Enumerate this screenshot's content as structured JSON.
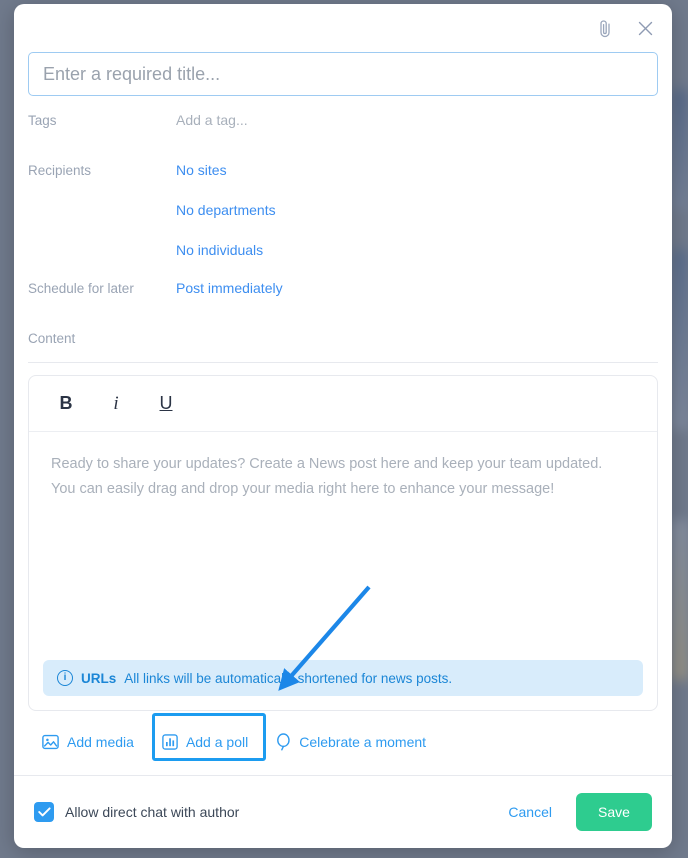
{
  "modal": {
    "header": {
      "attach_icon": "paperclip-icon",
      "close_icon": "close-icon"
    },
    "title_input": {
      "value": "",
      "placeholder": "Enter a required title..."
    },
    "fields": {
      "tags": {
        "label": "Tags",
        "value": "Add a tag..."
      },
      "recipients": {
        "label": "Recipients",
        "values": [
          "No sites",
          "No departments",
          "No individuals"
        ]
      },
      "schedule": {
        "label": "Schedule for later",
        "value": "Post immediately"
      },
      "content": {
        "label": "Content"
      }
    },
    "editor": {
      "toolbar": {
        "bold": "B",
        "italic": "i",
        "underline": "U"
      },
      "placeholder_line1": "Ready to share your updates? Create a News post here and keep your team updated.",
      "placeholder_line2": "You can easily drag and drop your media right here to enhance your message!",
      "notice": {
        "icon": "info-icon",
        "strong": "URLs",
        "text": "All links will be automatically shortened for news posts."
      }
    },
    "actions": [
      {
        "label": "Add media",
        "icon": "image-icon",
        "highlighted": false
      },
      {
        "label": "Add a poll",
        "icon": "bar-chart-icon",
        "highlighted": true
      },
      {
        "label": "Celebrate a moment",
        "icon": "balloon-icon",
        "highlighted": false
      }
    ],
    "footer": {
      "allow_chat_label": "Allow direct chat with author",
      "allow_chat_checked": true,
      "cancel_label": "Cancel",
      "save_label": "Save"
    }
  },
  "colors": {
    "accent_blue": "#2e9bf0",
    "link_blue": "#3d8ef0",
    "save_green": "#2ecc8f",
    "notice_bg": "#d8ecfb",
    "label_gray": "#9aa4b4",
    "highlight_border": "#1c9cf0"
  }
}
